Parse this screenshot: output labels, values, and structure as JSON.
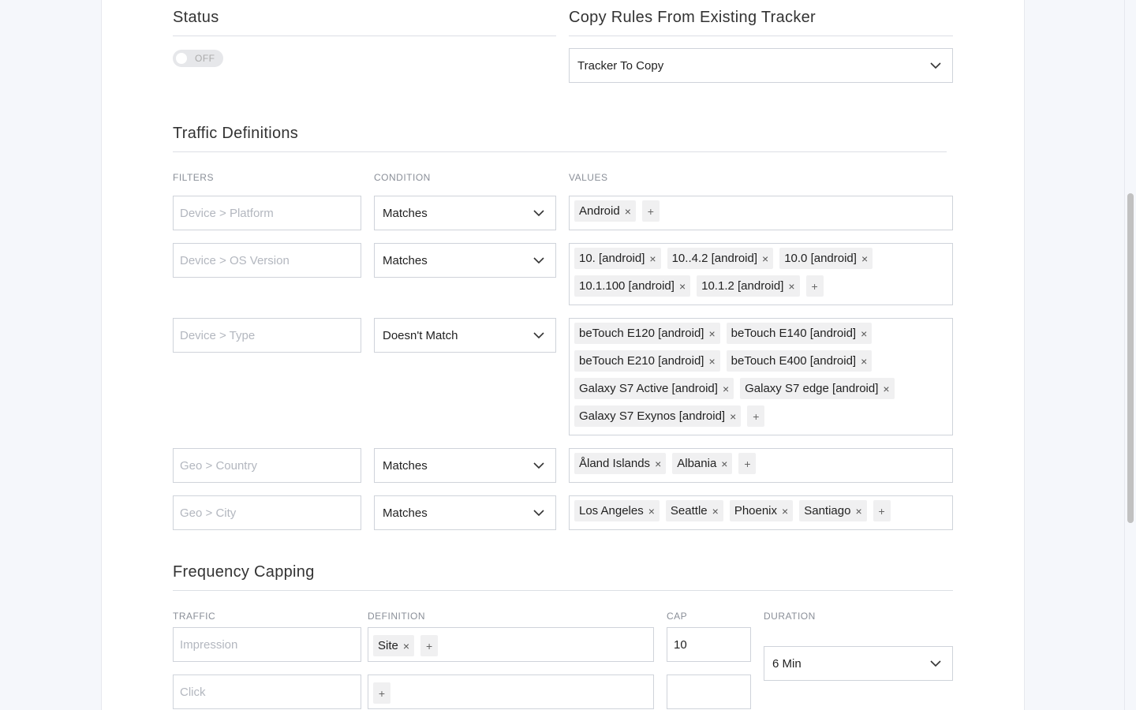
{
  "status": {
    "title": "Status",
    "toggle_label": "OFF"
  },
  "copy_rules": {
    "title": "Copy Rules From Existing Tracker",
    "select_value": "Tracker To Copy"
  },
  "traffic": {
    "title": "Traffic Definitions",
    "columns": {
      "filters": "FILTERS",
      "condition": "CONDITION",
      "values": "VALUES"
    },
    "rows": [
      {
        "filter_placeholder": "Device > Platform",
        "condition": "Matches",
        "values": [
          "Android"
        ]
      },
      {
        "filter_placeholder": "Device > OS Version",
        "condition": "Matches",
        "values": [
          "10. [android]",
          "10..4.2 [android]",
          "10.0 [android]",
          "10.1.100 [android]",
          "10.1.2 [android]"
        ]
      },
      {
        "filter_placeholder": "Device > Type",
        "condition": "Doesn't Match",
        "values": [
          "beTouch E120 [android]",
          "beTouch E140 [android]",
          "beTouch E210 [android]",
          "beTouch E400 [android]",
          "Galaxy S7 Active [android]",
          "Galaxy S7 edge [android]",
          "Galaxy S7 Exynos [android]"
        ]
      },
      {
        "filter_placeholder": "Geo > Country",
        "condition": "Matches",
        "values": [
          "Åland Islands",
          "Albania"
        ]
      },
      {
        "filter_placeholder": "Geo > City",
        "condition": "Matches",
        "values": [
          "Los Angeles",
          "Seattle",
          "Phoenix",
          "Santiago"
        ]
      }
    ]
  },
  "frequency": {
    "title": "Frequency Capping",
    "columns": {
      "traffic": "TRAFFIC",
      "definition": "DEFINITION",
      "cap": "CAP",
      "duration": "DURATION"
    },
    "rows": [
      {
        "traffic_placeholder": "Impression",
        "definition": [
          "Site"
        ],
        "cap": "10"
      },
      {
        "traffic_placeholder": "Click",
        "definition": [],
        "cap": ""
      }
    ],
    "duration_value": "6 Min"
  },
  "icons": {
    "remove": "×",
    "add": "+",
    "dropdown": "chevron-down-icon"
  }
}
